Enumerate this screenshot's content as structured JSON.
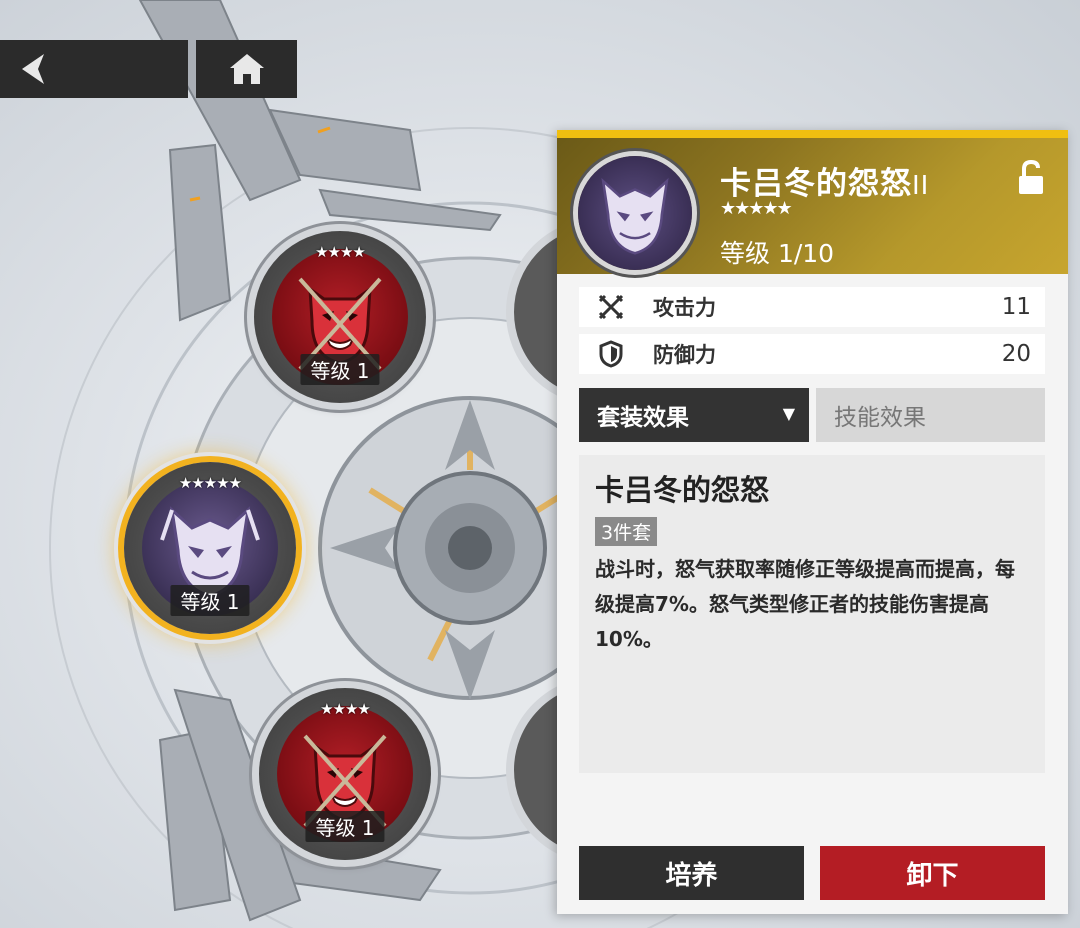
{
  "colors": {
    "accent_gold": "#f0bf10",
    "remove_red": "#b41d24",
    "dark_button": "#2f2f2f"
  },
  "nav": {
    "back_icon": "back-arrow-icon",
    "home_icon": "home-icon"
  },
  "slots": [
    {
      "stars": "★★★★",
      "level": "等级 1",
      "color": "red",
      "icon": "oni-mask-icon"
    },
    {
      "stars": "★★★★★",
      "level": "等级 1",
      "color": "purple",
      "icon": "dragon-mask-icon",
      "selected": true
    },
    {
      "stars": "★★★★",
      "level": "等级 1",
      "color": "red",
      "icon": "oni-mask-icon"
    }
  ],
  "panel": {
    "name": "卡吕冬的怨怒",
    "tier": "II",
    "stars": "★★★★★",
    "level": "等级 1/10",
    "lock_icon": "unlocked-padlock-icon",
    "stats": [
      {
        "icon": "attack-icon",
        "label": "攻击力",
        "value": "11"
      },
      {
        "icon": "defense-icon",
        "label": "防御力",
        "value": "20"
      }
    ],
    "tabs": {
      "active": "套装效果",
      "inactive": "技能效果"
    },
    "effect": {
      "title": "卡吕冬的怨怒",
      "set_badge": "3件套",
      "description": "战斗时，怒气获取率随修正等级提高而提高，每级提高7%。怒气类型修正者的技能伤害提高10%。"
    },
    "buttons": {
      "train": "培养",
      "remove": "卸下"
    }
  }
}
